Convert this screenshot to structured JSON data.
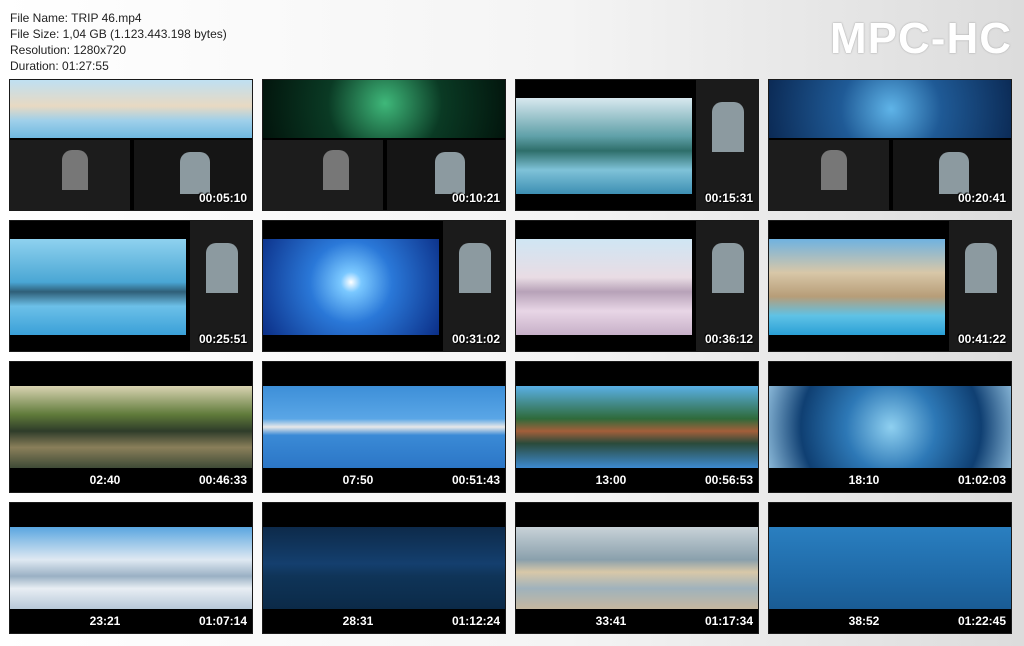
{
  "info": {
    "file_name": "File Name: TRIP 46.mp4",
    "file_size": "File Size: 1,04 GB (1.123.443.198 bytes)",
    "resolution": "Resolution: 1280x720",
    "duration": "Duration: 01:27:55"
  },
  "logo": "MPC-HC",
  "thumbnails": [
    {
      "timestamp": "00:05:10",
      "clock": ""
    },
    {
      "timestamp": "00:10:21",
      "clock": ""
    },
    {
      "timestamp": "00:15:31",
      "clock": ""
    },
    {
      "timestamp": "00:20:41",
      "clock": ""
    },
    {
      "timestamp": "00:25:51",
      "clock": ""
    },
    {
      "timestamp": "00:31:02",
      "clock": ""
    },
    {
      "timestamp": "00:36:12",
      "clock": ""
    },
    {
      "timestamp": "00:41:22",
      "clock": ""
    },
    {
      "timestamp": "00:46:33",
      "clock": "02:40"
    },
    {
      "timestamp": "00:51:43",
      "clock": "07:50"
    },
    {
      "timestamp": "00:56:53",
      "clock": "13:00"
    },
    {
      "timestamp": "01:02:03",
      "clock": "18:10"
    },
    {
      "timestamp": "01:07:14",
      "clock": "23:21"
    },
    {
      "timestamp": "01:12:24",
      "clock": "28:31"
    },
    {
      "timestamp": "01:17:34",
      "clock": "33:41"
    },
    {
      "timestamp": "01:22:45",
      "clock": "38:52"
    }
  ]
}
